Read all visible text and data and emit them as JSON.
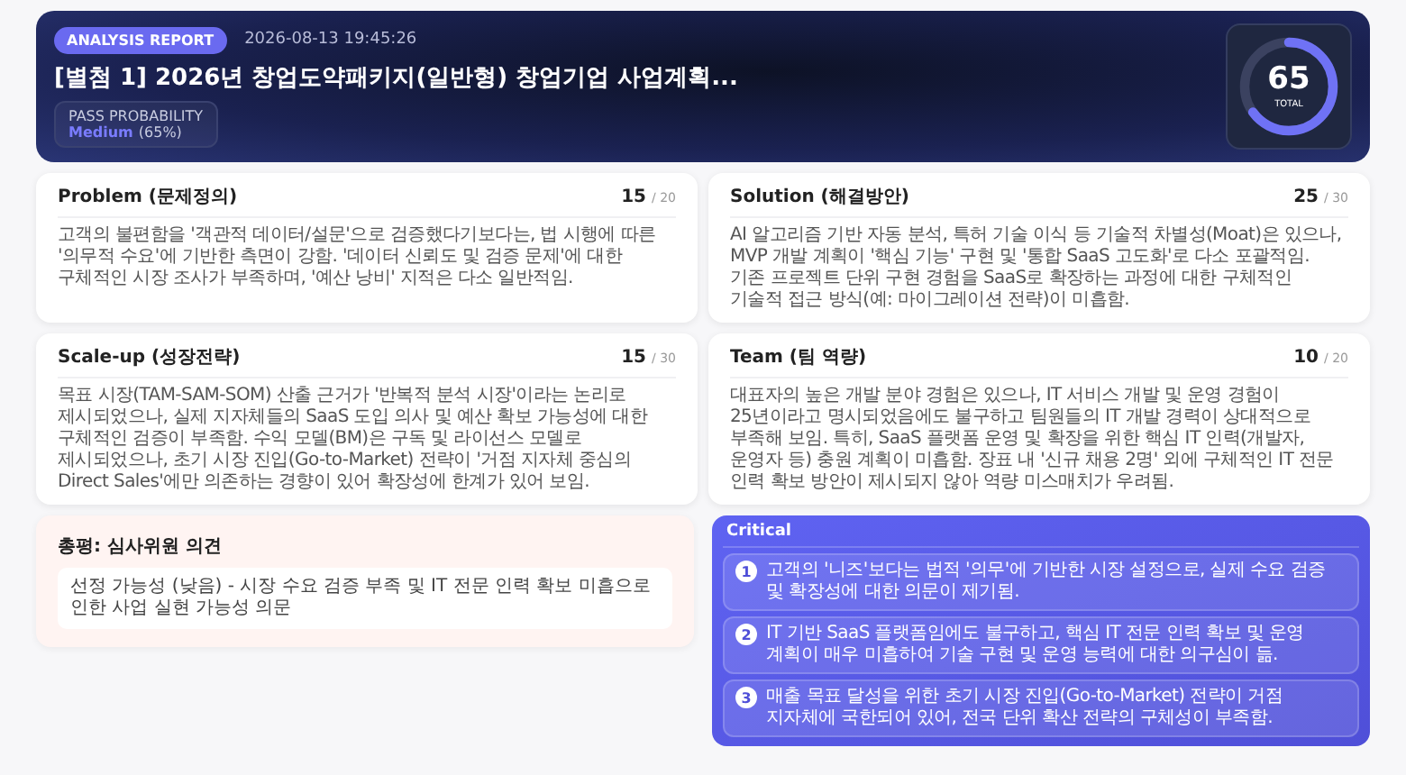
{
  "header": {
    "badge": "ANALYSIS REPORT",
    "timestamp": "2026-08-13 19:45:26",
    "title": "[별첨 1] 2026년 창업도약패키지(일반형) 창업기업 사업계획...",
    "pass_probability": {
      "label": "PASS PROBABILITY",
      "rating": "Medium",
      "percent": "(65%)"
    },
    "score": {
      "value": "65",
      "label": "TOTAL",
      "level": 0.65
    }
  },
  "sections": [
    {
      "title": "Problem (문제정의)",
      "score": "15",
      "max": "/ 20",
      "text": "고객의 불편함을 '객관적 데이터/설문'으로 검증했다기보다는, 법 시행에 따른 '의무적 수요'에 기반한 측면이 강함. '데이터 신뢰도 및 검증 문제'에 대한 구체적인 시장 조사가 부족하며, '예산 낭비' 지적은 다소 일반적임."
    },
    {
      "title": "Solution (해결방안)",
      "score": "25",
      "max": "/ 30",
      "text": "AI 알고리즘 기반 자동 분석, 특허 기술 이식 등 기술적 차별성(Moat)은 있으나, MVP 개발 계획이 '핵심 기능' 구현 및 '통합 SaaS 고도화'로 다소 포괄적임. 기존 프로젝트 단위 구현 경험을 SaaS로 확장하는 과정에 대한 구체적인 기술적 접근 방식(예: 마이그레이션 전략)이 미흡함."
    },
    {
      "title": "Scale-up (성장전략)",
      "score": "15",
      "max": "/ 30",
      "text": "목표 시장(TAM-SAM-SOM) 산출 근거가 '반복적 분석 시장'이라는 논리로 제시되었으나, 실제 지자체들의 SaaS 도입 의사 및 예산 확보 가능성에 대한 구체적인 검증이 부족함. 수익 모델(BM)은 구독 및 라이선스 모델로 제시되었으나, 초기 시장 진입(Go-to-Market) 전략이 '거점 지자체 중심의 Direct Sales'에만 의존하는 경향이 있어 확장성에 한계가 있어 보임."
    },
    {
      "title": "Team (팀 역량)",
      "score": "10",
      "max": "/ 20",
      "text": "대표자의 높은 개발 분야 경험은 있으나, IT 서비스 개발 및 운영 경험이 25년이라고 명시되었음에도 불구하고 팀원들의 IT 개발 경력이 상대적으로 부족해 보임. 특히, SaaS 플랫폼 운영 및 확장을 위한 핵심 IT 인력(개발자, 운영자 등) 충원 계획이 미흡함. 장표 내 '신규 채용 2명' 외에 구체적인 IT 전문 인력 확보 방안이 제시되지 않아 역량 미스매치가 우려됨."
    }
  ],
  "summary": {
    "title": "총평: 심사위원 의견",
    "verdict": "선정 가능성 (낮음) - 시장 수요 검증 부족 및 IT 전문 인력 확보 미흡으로 인한 사업 실현 가능성 의문"
  },
  "critical": {
    "title": "Critical",
    "items": [
      {
        "number": "1",
        "text": "고객의 '니즈'보다는 법적 '의무'에 기반한 시장 설정으로, 실제 수요 검증 및 확장성에 대한 의문이 제기됨."
      },
      {
        "number": "2",
        "text": "IT 기반 SaaS 플랫폼임에도 불구하고, 핵심 IT 전문 인력 확보 및 운영 계획이 매우 미흡하여 기술 구현 및 운영 능력에 대한 의구심이 듦."
      },
      {
        "number": "3",
        "text": "매출 목표 달성을 위한 초기 시장 진입(Go-to-Market) 전략이 거점 지자체에 국한되어 있어, 전국 단위 확산 전략의 구체성이 부족함."
      }
    ]
  }
}
